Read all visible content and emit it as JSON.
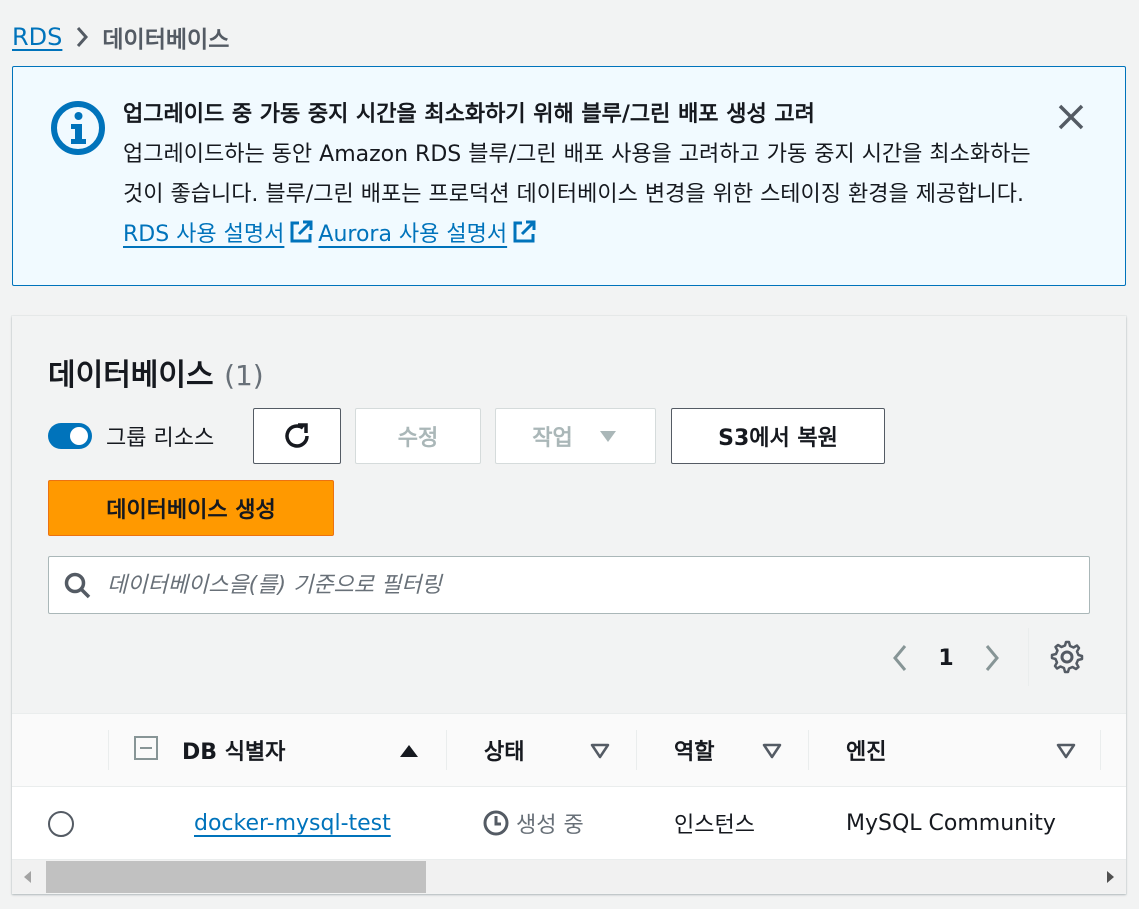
{
  "breadcrumb": {
    "root": "RDS",
    "current": "데이터베이스"
  },
  "alert": {
    "title": "업그레이드 중 가동 중지 시간을 최소화하기 위해 블루/그린 배포 생성 고려",
    "body": "업그레이드하는 동안 Amazon RDS 블루/그린 배포 사용을 고려하고 가동 중지 시간을 최소화하는 것이 좋습니다. 블루/그린 배포는 프로덕션 데이터베이스 변경을 위한 스테이징 환경을 제공합니다.",
    "link_rds": "RDS 사용 설명서",
    "link_aurora": "Aurora 사용 설명서"
  },
  "panel": {
    "title": "데이터베이스",
    "count": "(1)",
    "group_toggle_label": "그룹 리소스",
    "group_toggle_on": true,
    "edit_label": "수정",
    "actions_label": "작업",
    "restore_label": "S3에서 복원",
    "create_label": "데이터베이스 생성",
    "search_placeholder": "데이터베이스을(를) 기준으로 필터링",
    "page": "1"
  },
  "table": {
    "columns": [
      "DB 식별자",
      "상태",
      "역할",
      "엔진"
    ],
    "rows": [
      {
        "identifier": "docker-mysql-test",
        "status": "생성 중",
        "role": "인스턴스",
        "engine": "MySQL Community"
      }
    ]
  },
  "colors": {
    "link": "#0073bb",
    "primary": "#ff9900",
    "info_bg": "#f1faff"
  }
}
